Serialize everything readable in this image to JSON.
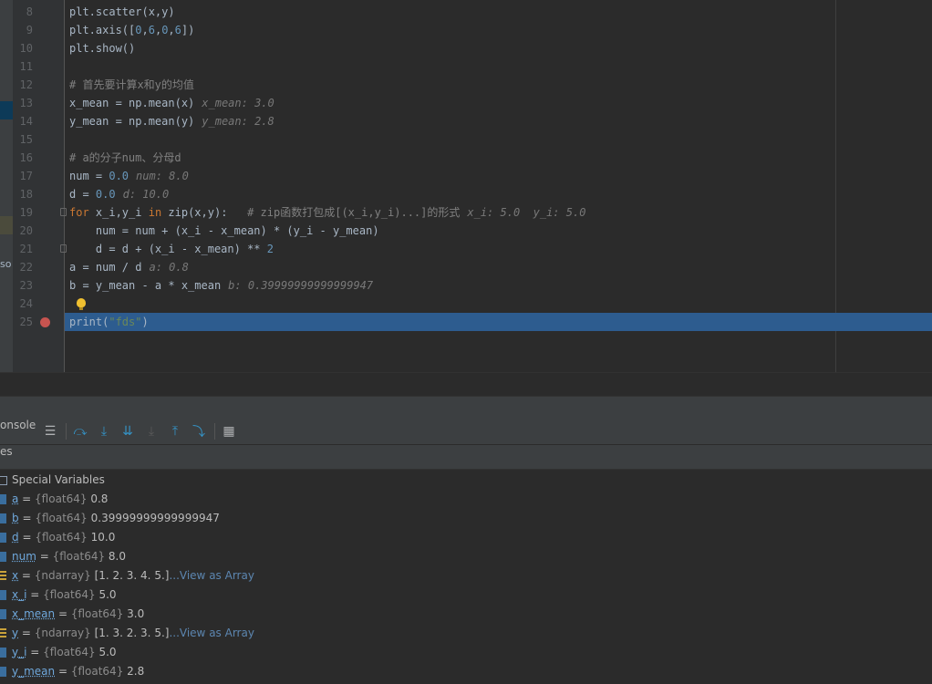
{
  "editor": {
    "lines": [
      {
        "n": "8",
        "code": "plt.scatter(x,y)"
      },
      {
        "n": "9",
        "code": "plt.axis([0,6,0,6])"
      },
      {
        "n": "10",
        "code": "plt.show()"
      },
      {
        "n": "11",
        "code": ""
      },
      {
        "n": "12",
        "code": "# 首先要计算x和y的均值"
      },
      {
        "n": "13",
        "code": "x_mean = np.mean(x)",
        "hint": "x_mean: 3.0"
      },
      {
        "n": "14",
        "code": "y_mean = np.mean(y)",
        "hint": "y_mean: 2.8"
      },
      {
        "n": "15",
        "code": ""
      },
      {
        "n": "16",
        "code": "# a的分子num、分母d"
      },
      {
        "n": "17",
        "code": "num = 0.0",
        "hint": "num: 8.0"
      },
      {
        "n": "18",
        "code": "d = 0.0",
        "hint": "d: 10.0"
      },
      {
        "n": "19",
        "code": "for x_i,y_i in zip(x,y):   # zip函数打包成[(x_i,y_i)...]的形式",
        "hint": "x_i: 5.0  y_i: 5.0"
      },
      {
        "n": "20",
        "code": "    num = num + (x_i - x_mean) * (y_i - y_mean)"
      },
      {
        "n": "21",
        "code": "    d = d + (x_i - x_mean) ** 2"
      },
      {
        "n": "22",
        "code": "a = num / d",
        "hint": "a: 0.8"
      },
      {
        "n": "23",
        "code": "b = y_mean - a * x_mean",
        "hint": "b: 0.39999999999999947"
      },
      {
        "n": "24",
        "code": ""
      },
      {
        "n": "25",
        "code": "print(\"fds\")"
      }
    ],
    "left_strip_text": "so"
  },
  "debug": {
    "console_tab": "onsole",
    "variables_tab": "es"
  },
  "variables": [
    {
      "name": "Special Variables",
      "special": true
    },
    {
      "name": "a",
      "type": "{float64}",
      "value": "0.8"
    },
    {
      "name": "b",
      "type": "{float64}",
      "value": "0.39999999999999947"
    },
    {
      "name": "d",
      "type": "{float64}",
      "value": "10.0"
    },
    {
      "name": "num",
      "type": "{float64}",
      "value": "8.0"
    },
    {
      "name": "x",
      "type": "{ndarray}",
      "value": "[1. 2. 3. 4. 5.]",
      "link": "...View as Array",
      "array": true
    },
    {
      "name": "x_i",
      "type": "{float64}",
      "value": "5.0"
    },
    {
      "name": "x_mean",
      "type": "{float64}",
      "value": "3.0"
    },
    {
      "name": "y",
      "type": "{ndarray}",
      "value": "[1. 3. 2. 3. 5.]",
      "link": "...View as Array",
      "array": true
    },
    {
      "name": "y_i",
      "type": "{float64}",
      "value": "5.0"
    },
    {
      "name": "y_mean",
      "type": "{float64}",
      "value": "2.8"
    }
  ]
}
